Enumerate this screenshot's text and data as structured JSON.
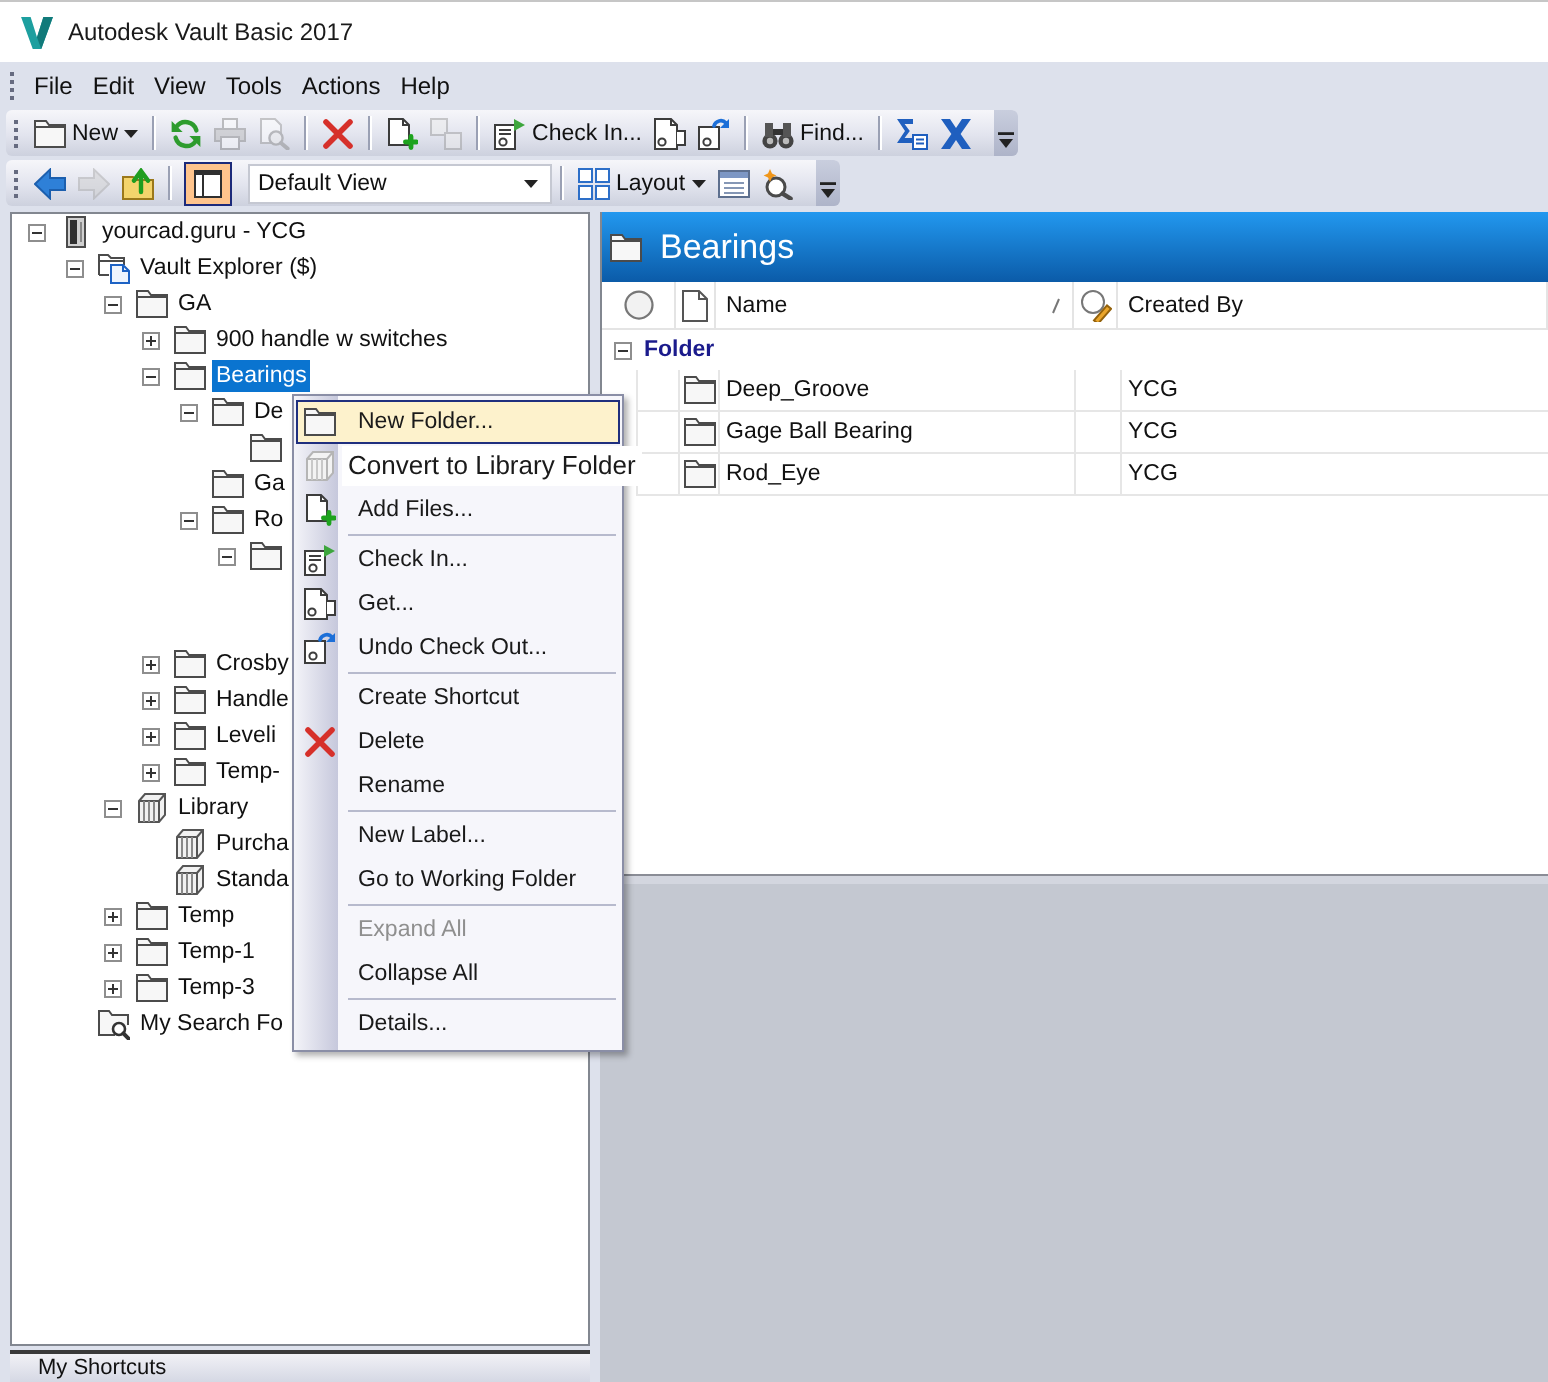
{
  "window": {
    "title": "Autodesk Vault Basic 2017"
  },
  "menu_bar": [
    "File",
    "Edit",
    "View",
    "Tools",
    "Actions",
    "Help"
  ],
  "toolbars": [
    {
      "items": [
        {
          "kind": "button",
          "label": "New",
          "has_menu": true,
          "disabled": false
        },
        {
          "kind": "separator"
        },
        {
          "kind": "icon",
          "disabled": false
        },
        {
          "kind": "icon",
          "disabled": true
        },
        {
          "kind": "icon",
          "disabled": true
        },
        {
          "kind": "separator"
        },
        {
          "kind": "icon",
          "disabled": false
        },
        {
          "kind": "separator"
        },
        {
          "kind": "icon",
          "disabled": false
        },
        {
          "kind": "icon",
          "disabled": true
        },
        {
          "kind": "separator"
        },
        {
          "kind": "button",
          "label": "Check In...",
          "has_menu": false,
          "disabled": false
        },
        {
          "kind": "icon",
          "disabled": false
        },
        {
          "kind": "icon",
          "disabled": false
        },
        {
          "kind": "separator"
        },
        {
          "kind": "button",
          "label": "Find...",
          "has_menu": false,
          "disabled": false
        },
        {
          "kind": "separator"
        },
        {
          "kind": "icon",
          "disabled": false
        },
        {
          "kind": "icon",
          "disabled": false
        }
      ]
    },
    {
      "items": [
        {
          "kind": "icon",
          "disabled": false
        },
        {
          "kind": "icon",
          "disabled": true
        },
        {
          "kind": "icon",
          "disabled": false
        },
        {
          "kind": "separator"
        },
        {
          "kind": "toggle",
          "checked": true
        },
        {
          "kind": "select",
          "value": "Default View"
        },
        {
          "kind": "separator"
        },
        {
          "kind": "button",
          "label": "Layout",
          "has_menu": true,
          "disabled": false
        },
        {
          "kind": "icon",
          "disabled": false
        },
        {
          "kind": "icon",
          "disabled": false
        }
      ]
    }
  ],
  "tree": [
    {
      "label": "yourcad.guru - YCG",
      "kind": "server",
      "expanded": true,
      "selected": false,
      "children": [
        {
          "label": "Vault Explorer ($)",
          "kind": "vault",
          "expanded": true,
          "selected": false,
          "children": [
            {
              "label": "GA",
              "kind": "folder",
              "expanded": true,
              "selected": false,
              "children": [
                {
                  "label": "900 handle w switches",
                  "kind": "folder",
                  "expanded": false,
                  "selected": false
                },
                {
                  "label": "Bearings",
                  "kind": "folder",
                  "expanded": true,
                  "selected": true,
                  "children": [
                    {
                      "label": "De",
                      "kind": "folder",
                      "expanded": true,
                      "selected": false,
                      "children": [
                        {
                          "kind": "folder",
                          "selected": false
                        }
                      ]
                    },
                    {
                      "label": "Ga",
                      "kind": "folder",
                      "selected": false
                    },
                    {
                      "label": "Ro",
                      "kind": "folder",
                      "expanded": true,
                      "selected": false,
                      "children": [
                        {
                          "kind": "folder",
                          "expanded": true,
                          "selected": false
                        }
                      ]
                    }
                  ]
                },
                {
                  "label": "Crosby",
                  "kind": "folder",
                  "expanded": false,
                  "selected": false
                },
                {
                  "label": "Handle",
                  "kind": "folder",
                  "expanded": false,
                  "selected": false
                },
                {
                  "label": "Leveli",
                  "kind": "folder",
                  "expanded": false,
                  "selected": false
                },
                {
                  "label": "Temp-",
                  "kind": "folder",
                  "expanded": false,
                  "selected": false
                }
              ]
            },
            {
              "label": "Library",
              "kind": "library",
              "expanded": true,
              "selected": false,
              "children": [
                {
                  "label": "Purcha",
                  "kind": "library",
                  "selected": false
                },
                {
                  "label": "Standa",
                  "kind": "library",
                  "selected": false
                }
              ]
            },
            {
              "label": "Temp",
              "kind": "folder",
              "expanded": false,
              "selected": false
            },
            {
              "label": "Temp-1",
              "kind": "folder",
              "expanded": false,
              "selected": false
            },
            {
              "label": "Temp-3",
              "kind": "folder",
              "expanded": false,
              "selected": false
            }
          ]
        },
        {
          "label": "My Search Fo",
          "kind": "search_folder",
          "selected": false
        }
      ]
    }
  ],
  "content": {
    "title": "Bearings",
    "columns": [
      {
        "label": "Name",
        "sorted": true
      },
      {
        "label": "Created By",
        "sorted": false
      }
    ],
    "groups": [
      {
        "label": "Folder",
        "expanded": true,
        "rows": [
          {
            "name": "Deep_Groove",
            "created_by": "YCG"
          },
          {
            "name": "Gage Ball Bearing",
            "created_by": "YCG"
          },
          {
            "name": "Rod_Eye",
            "created_by": "YCG"
          }
        ]
      }
    ]
  },
  "context_menu": {
    "groups": [
      {
        "items": [
          {
            "label": "New Folder...",
            "kind": "normal",
            "selected": true,
            "disabled": false
          },
          {
            "label": "Convert to Library Folder",
            "kind": "overflow",
            "selected": false,
            "disabled": false
          },
          {
            "label": "Add Files...",
            "kind": "normal",
            "selected": false,
            "disabled": false
          }
        ]
      },
      {
        "items": [
          {
            "label": "Check In...",
            "kind": "normal",
            "selected": false,
            "disabled": false
          },
          {
            "label": "Get...",
            "kind": "normal",
            "selected": false,
            "disabled": false
          },
          {
            "label": "Undo Check Out...",
            "kind": "normal",
            "selected": false,
            "disabled": false
          }
        ]
      },
      {
        "items": [
          {
            "label": "Create Shortcut",
            "kind": "normal",
            "selected": false,
            "disabled": false
          },
          {
            "label": "Delete",
            "kind": "normal",
            "selected": false,
            "disabled": false
          },
          {
            "label": "Rename",
            "kind": "normal",
            "selected": false,
            "disabled": false
          }
        ]
      },
      {
        "items": [
          {
            "label": "New Label...",
            "kind": "normal",
            "selected": false,
            "disabled": false
          },
          {
            "label": "Go to Working Folder",
            "kind": "normal",
            "selected": false,
            "disabled": false
          }
        ]
      },
      {
        "items": [
          {
            "label": "Expand All",
            "kind": "normal",
            "selected": false,
            "disabled": true
          },
          {
            "label": "Collapse All",
            "kind": "normal",
            "selected": false,
            "disabled": false
          }
        ]
      },
      {
        "items": [
          {
            "label": "Details...",
            "kind": "normal",
            "selected": false,
            "disabled": false
          }
        ]
      }
    ]
  },
  "shortcuts_bar": {
    "label": "My Shortcuts"
  }
}
